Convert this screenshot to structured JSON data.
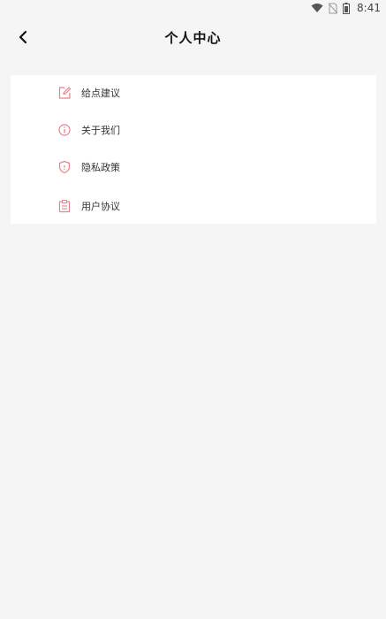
{
  "status_bar": {
    "time": "8:41",
    "icons": [
      "wifi-icon",
      "no-sim-icon",
      "battery-icon"
    ]
  },
  "header": {
    "title": "个人中心",
    "back_icon": "chevron-left-icon"
  },
  "menu": {
    "items": [
      {
        "label": "给点建议",
        "icon": "edit-icon"
      },
      {
        "label": "关于我们",
        "icon": "info-icon"
      },
      {
        "label": "隐私政策",
        "icon": "shield-icon"
      },
      {
        "label": "用户协议",
        "icon": "clipboard-icon"
      }
    ]
  },
  "colors": {
    "accent": "#e9818a",
    "background": "#f5f5f5",
    "card": "#ffffff"
  }
}
